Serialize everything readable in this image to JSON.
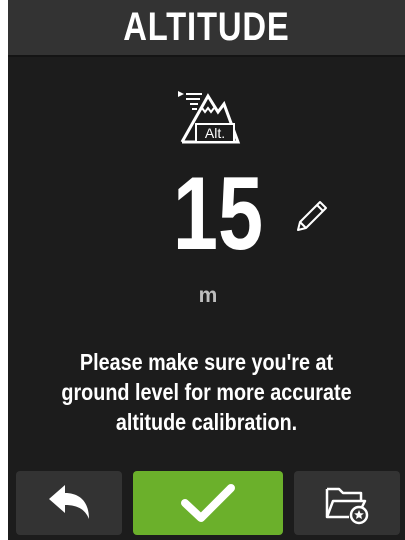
{
  "header": {
    "title": "ALTITUDE"
  },
  "icon": {
    "name": "altitude-mountain-icon",
    "label": "Alt."
  },
  "reading": {
    "value": "15",
    "unit": "m"
  },
  "message": "Please make sure you're at ground level for more accurate altitude calibration.",
  "toolbar": {
    "back_icon": "back-arrow-icon",
    "confirm_icon": "checkmark-icon",
    "folder_icon": "folder-star-icon"
  },
  "colors": {
    "background": "#1c1c1c",
    "header": "#333333",
    "accent_green": "#6bb02b",
    "unit_text": "#bdbdbd"
  }
}
